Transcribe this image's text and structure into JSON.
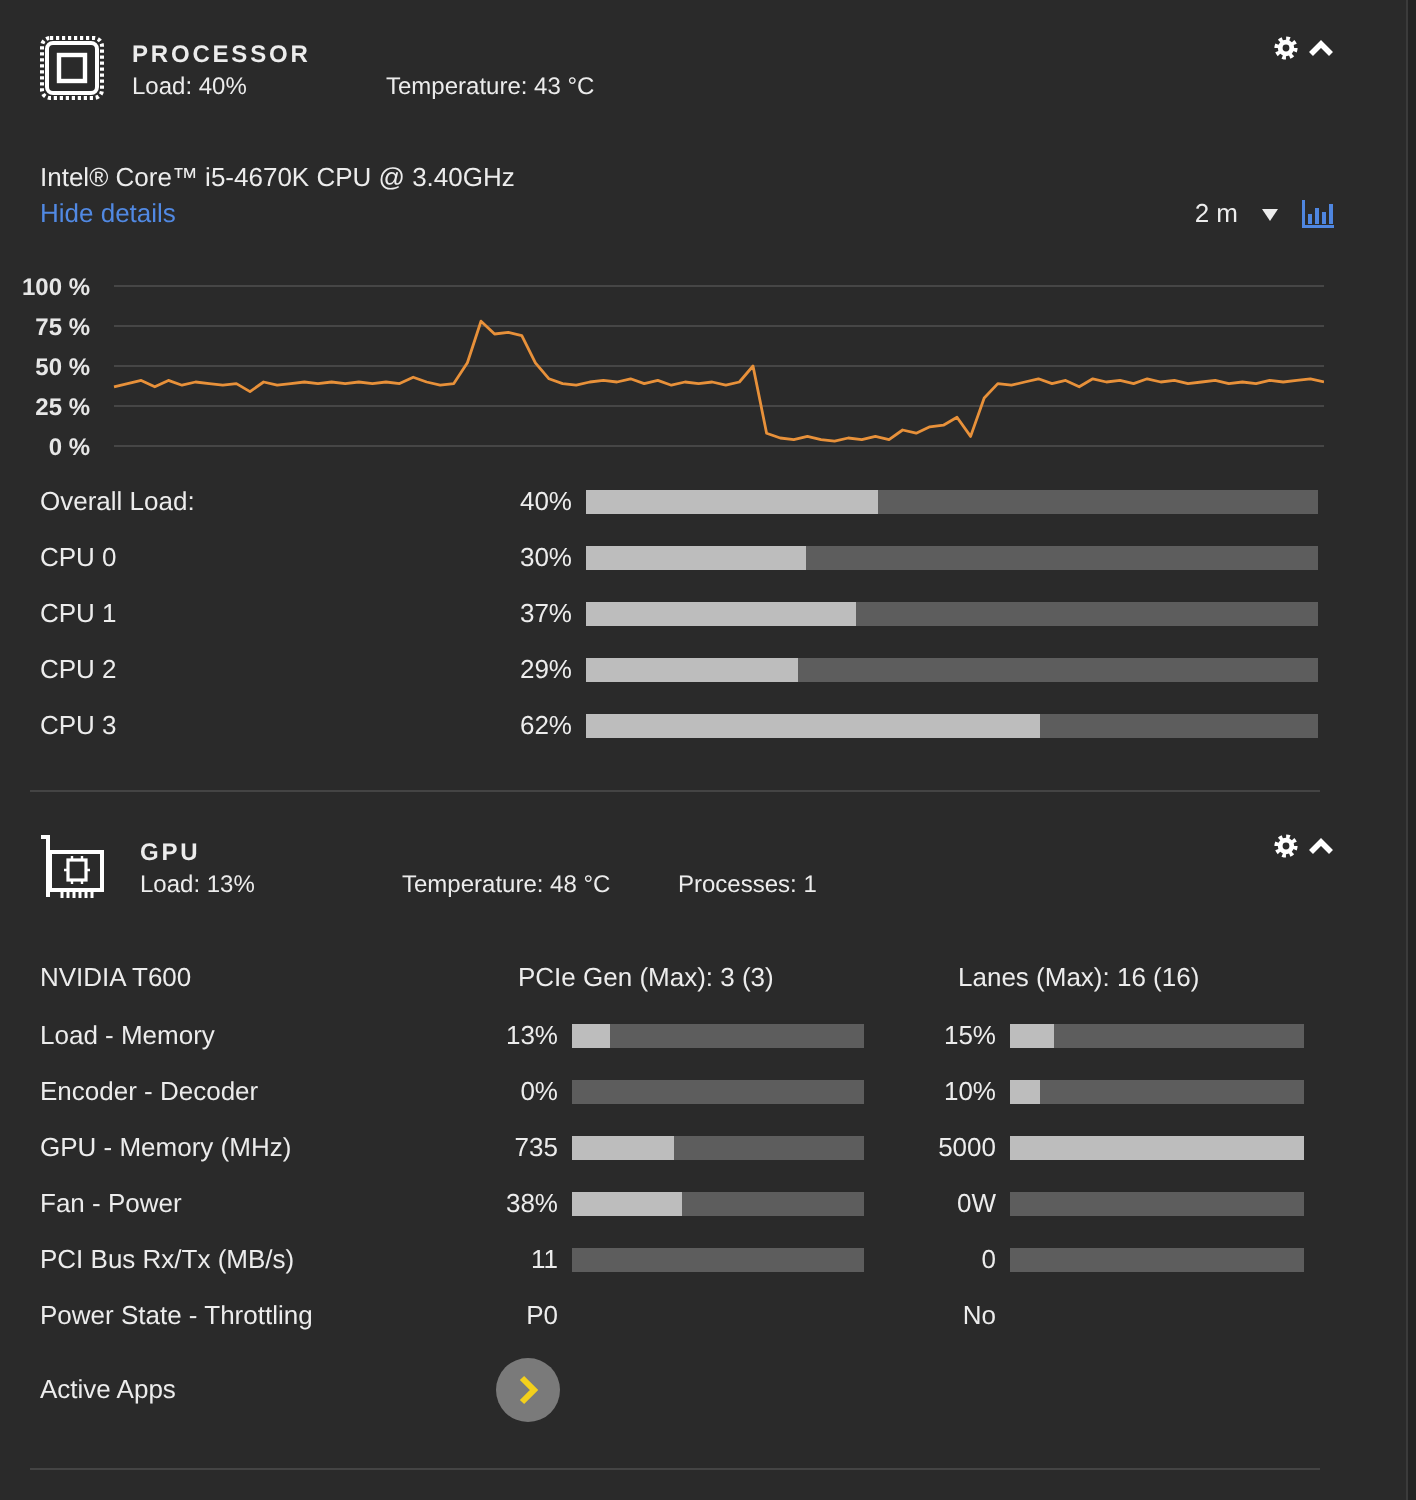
{
  "processor": {
    "title": "PROCESSOR",
    "expanded": true,
    "stats": [
      "Load: 40%",
      "Temperature: 43 °C"
    ],
    "model": "Intel® Core™ i5-4670K CPU @ 3.40GHz",
    "details_link": "Hide details",
    "time_range": "2 m",
    "chart_data": {
      "type": "line",
      "grid": true,
      "ylim": [
        0,
        100
      ],
      "yticks": [
        {
          "value": 100,
          "label": "100 %"
        },
        {
          "value": 75,
          "label": "75 %"
        },
        {
          "value": 50,
          "label": "50 %"
        },
        {
          "value": 25,
          "label": "25 %"
        },
        {
          "value": 0,
          "label": "0 %"
        }
      ],
      "series": [
        {
          "color": "#e8913a",
          "values": [
            37,
            39,
            41,
            37,
            41,
            38,
            40,
            39,
            38,
            39,
            34,
            40,
            38,
            39,
            40,
            39,
            40,
            39,
            40,
            39,
            40,
            39,
            43,
            40,
            38,
            39,
            52,
            78,
            70,
            71,
            69,
            52,
            42,
            39,
            38,
            40,
            41,
            40,
            42,
            39,
            41,
            38,
            40,
            39,
            40,
            38,
            40,
            50,
            8,
            5,
            4,
            6,
            4,
            3,
            5,
            4,
            6,
            4,
            10,
            8,
            12,
            13,
            18,
            6,
            30,
            39,
            38,
            40,
            42,
            39,
            41,
            37,
            42,
            40,
            41,
            39,
            42,
            40,
            41,
            39,
            40,
            41,
            39,
            40,
            39,
            41,
            40,
            41,
            42,
            40
          ]
        }
      ]
    },
    "loads": [
      {
        "label": "Overall Load:",
        "value": "40%",
        "level": 0.4
      },
      {
        "label": "CPU 0",
        "value": "30%",
        "level": 0.3
      },
      {
        "label": "CPU 1",
        "value": "37%",
        "level": 0.37
      },
      {
        "label": "CPU 2",
        "value": "29%",
        "level": 0.29
      },
      {
        "label": "CPU 3",
        "value": "62%",
        "level": 0.62
      }
    ]
  },
  "gpu": {
    "title": "GPU",
    "expanded": true,
    "stats": [
      "Load: 13%",
      "Temperature: 48 °C",
      "Processes: 1"
    ],
    "model": "NVIDIA T600",
    "pcie": "PCIe Gen (Max): 3 (3)",
    "lanes": "Lanes (Max): 16 (16)",
    "metrics": [
      {
        "label": "Load - Memory",
        "kind": "meter",
        "cells": [
          {
            "value": "13%",
            "level": 0.13
          },
          {
            "value": "15%",
            "level": 0.15
          }
        ]
      },
      {
        "label": "Encoder - Decoder",
        "kind": "meter",
        "cells": [
          {
            "value": "0%",
            "level": 0
          },
          {
            "value": "10%",
            "level": 0.1
          }
        ]
      },
      {
        "label": "GPU - Memory (MHz)",
        "kind": "meter",
        "cells": [
          {
            "value": "735",
            "level": 0.35
          },
          {
            "value": "5000",
            "level": 1
          }
        ]
      },
      {
        "label": "Fan - Power",
        "kind": "meter",
        "cells": [
          {
            "value": "38%",
            "level": 0.38
          },
          {
            "value": "0W",
            "level": 0
          }
        ]
      },
      {
        "label": "PCI Bus Rx/Tx (MB/s)",
        "kind": "meter",
        "cells": [
          {
            "value": "11",
            "level": 0
          },
          {
            "value": "0",
            "level": 0
          }
        ]
      },
      {
        "label": "Power State - Throttling",
        "kind": "text",
        "cells": [
          {
            "value": "P0"
          },
          {
            "value": "No"
          }
        ]
      }
    ],
    "active_apps": "Active Apps"
  }
}
